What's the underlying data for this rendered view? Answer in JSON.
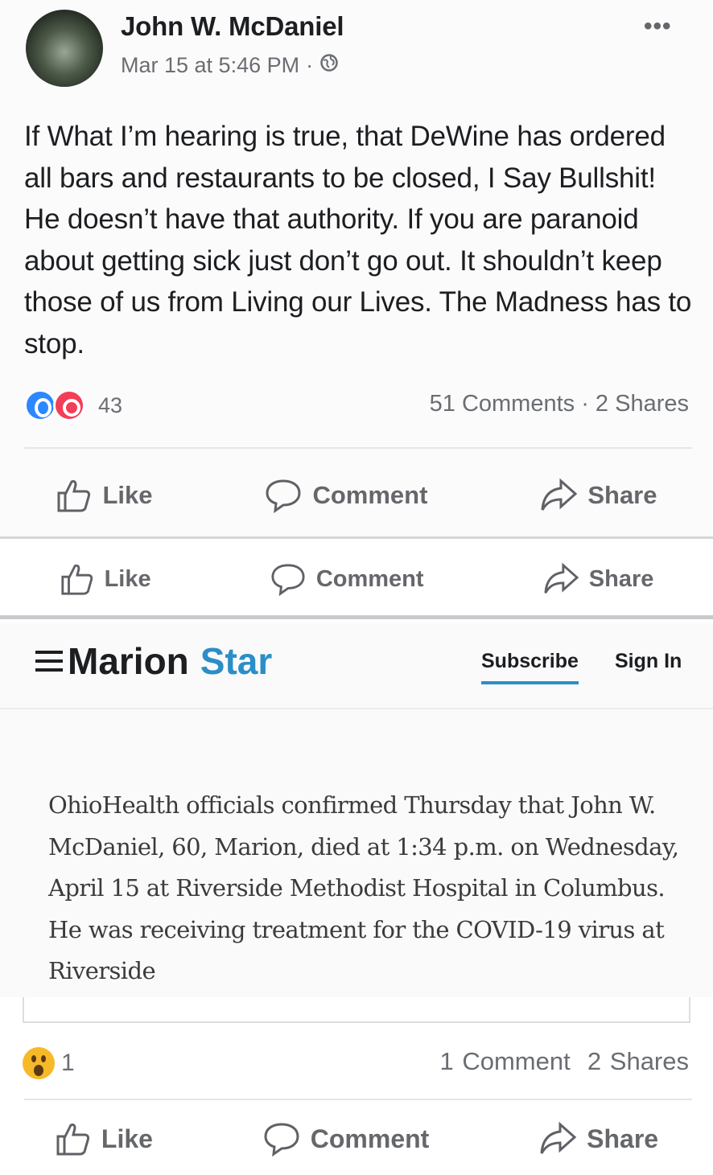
{
  "post": {
    "author": "John W. McDaniel",
    "timestamp": "Mar 15 at 5:46 PM",
    "separator": "·",
    "privacy_icon": "globe-icon",
    "more_label": "•••",
    "body": "If What I’m hearing is true, that DeWine has ordered all bars and restaurants to be closed, I Say Bullshit! He doesn’t have that authority. If you are paranoid about getting sick just don’t go out. It shouldn’t keep those of us from Living our Lives. The Madness has to stop.",
    "reactions": {
      "icons": [
        "like-reaction-icon",
        "love-reaction-icon"
      ],
      "count": "43"
    },
    "stats": "51 Comments · 2 Shares",
    "actions": {
      "like": "Like",
      "comment": "Comment",
      "share": "Share"
    }
  },
  "shared_post": {
    "actions": {
      "like": "Like",
      "comment": "Comment",
      "share": "Share"
    },
    "article": {
      "brand_primary": "Marion",
      "brand_accent": "Star",
      "brand_accent_color": "#2b8ec8",
      "subscribe_label": "Subscribe",
      "signin_label": "Sign In",
      "excerpt": "OhioHealth officials confirmed Thursday that John W. McDaniel, 60, Marion, died at 1:34 p.m. on Wednesday, April 15 at Riverside Methodist Hospital in Columbus. He was receiving treatment for the COVID-19 virus at Riverside"
    },
    "reactions": {
      "icon": "wow-reaction-icon",
      "count": "1"
    },
    "stats": "1 Comment  2 Shares",
    "footer_actions": {
      "like": "Like",
      "comment": "Comment",
      "share": "Share"
    }
  }
}
